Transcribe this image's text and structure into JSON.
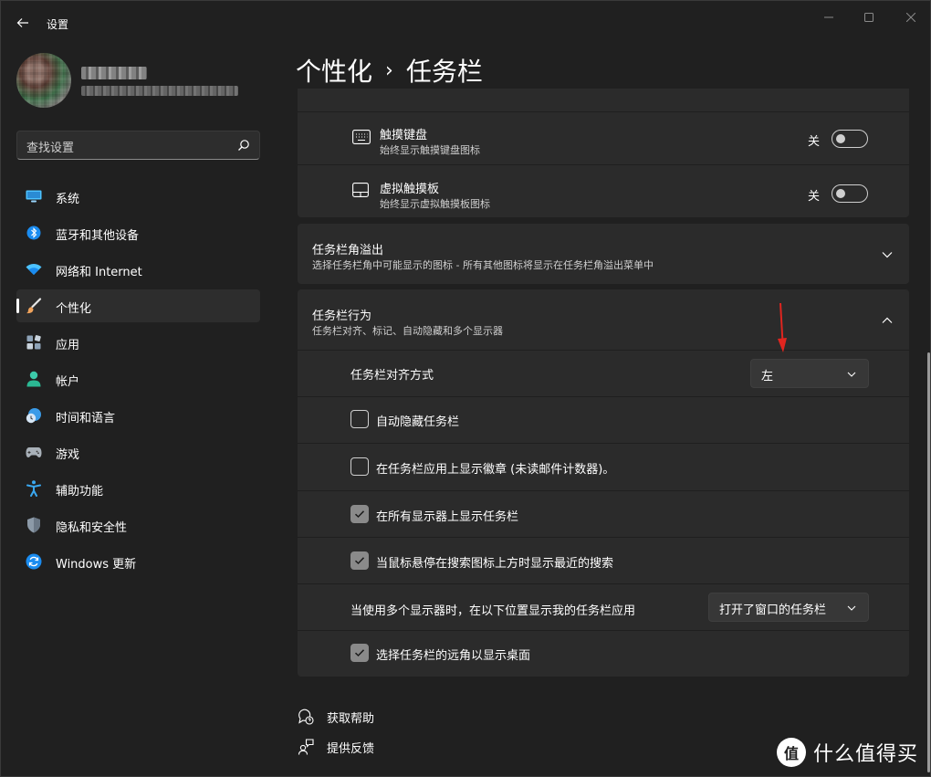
{
  "window": {
    "title": "设置"
  },
  "profile": {
    "name": "████",
    "email": "██████████████████"
  },
  "search": {
    "placeholder": "查找设置"
  },
  "nav": {
    "items": [
      {
        "label": "系统",
        "icon": "system-icon",
        "active": false
      },
      {
        "label": "蓝牙和其他设备",
        "icon": "bluetooth-icon",
        "active": false
      },
      {
        "label": "网络和 Internet",
        "icon": "wifi-icon",
        "active": false
      },
      {
        "label": "个性化",
        "icon": "brush-icon",
        "active": true
      },
      {
        "label": "应用",
        "icon": "apps-icon",
        "active": false
      },
      {
        "label": "帐户",
        "icon": "account-icon",
        "active": false
      },
      {
        "label": "时间和语言",
        "icon": "clock-globe-icon",
        "active": false
      },
      {
        "label": "游戏",
        "icon": "gamepad-icon",
        "active": false
      },
      {
        "label": "辅助功能",
        "icon": "accessibility-icon",
        "active": false
      },
      {
        "label": "隐私和安全性",
        "icon": "shield-icon",
        "active": false
      },
      {
        "label": "Windows 更新",
        "icon": "update-icon",
        "active": false
      }
    ]
  },
  "header": {
    "parent": "个性化",
    "separator": "›",
    "current": "任务栏"
  },
  "tray_items": {
    "touch_keyboard": {
      "title": "触摸键盘",
      "subtitle": "始终显示触摸键盘图标",
      "state_label": "关",
      "on": false
    },
    "virtual_touchpad": {
      "title": "虚拟触摸板",
      "subtitle": "始终显示虚拟触摸板图标",
      "state_label": "关",
      "on": false
    }
  },
  "corner_overflow": {
    "title": "任务栏角溢出",
    "subtitle": "选择任务栏角中可能显示的图标 - 所有其他图标将显示在任务栏角溢出菜单中"
  },
  "behaviors": {
    "title": "任务栏行为",
    "subtitle": "任务栏对齐、标记、自动隐藏和多个显示器",
    "alignment": {
      "label": "任务栏对齐方式",
      "value": "左"
    },
    "auto_hide": {
      "label": "自动隐藏任务栏",
      "checked": false
    },
    "badges": {
      "label": "在任务栏应用上显示徽章 (未读邮件计数器)。",
      "checked": false
    },
    "all_displays": {
      "label": "在所有显示器上显示任务栏",
      "checked": true
    },
    "recent_search": {
      "label": "当鼠标悬停在搜索图标上方时显示最近的搜索",
      "checked": true
    },
    "multi_display": {
      "label": "当使用多个显示器时，在以下位置显示我的任务栏应用",
      "value": "打开了窗口的任务栏"
    },
    "far_corner": {
      "label": "选择任务栏的远角以显示桌面",
      "checked": true
    }
  },
  "footer": {
    "help": "获取帮助",
    "feedback": "提供反馈"
  },
  "watermark": {
    "logo": "值",
    "text": "什么值得买"
  },
  "colors": {
    "background": "#202020",
    "card": "#2b2b2b",
    "accent_checkbox": "#8a8a8a",
    "annotation": "#e0251f"
  }
}
